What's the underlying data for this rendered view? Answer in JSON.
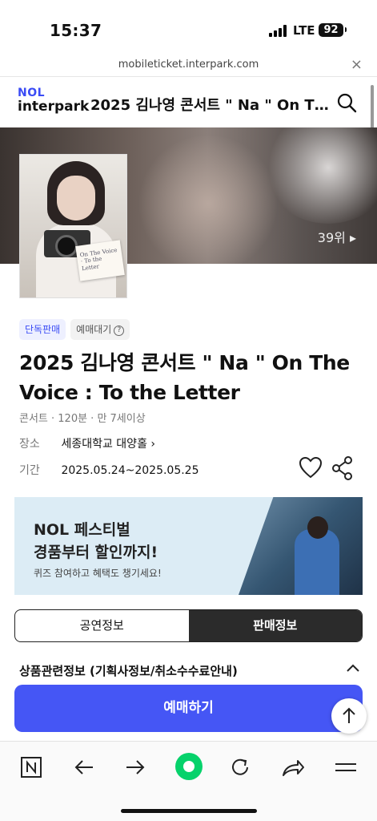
{
  "status": {
    "time": "15:37",
    "network": "LTE",
    "battery": "92"
  },
  "browser": {
    "url": "mobileticket.interpark.com",
    "close_glyph": "×"
  },
  "header": {
    "logo_top": "NOL",
    "logo_bottom": "interpark",
    "title": "2025 김나영 콘서트 \" Na \" On Th..."
  },
  "hero": {
    "rank": "39위 ▸"
  },
  "poster": {
    "card_text": "On The Voice · To the Letter"
  },
  "badges": {
    "exclusive": "단독판매",
    "waiting": "예매대기",
    "help": "?"
  },
  "product": {
    "title": "2025 김나영 콘서트 \" Na \" On The Voice : To the Letter",
    "meta": "콘서트 · 120분 · 만 7세이상",
    "venue_label": "장소",
    "venue": "세종대학교 대양홀 ›",
    "period_label": "기간",
    "period": "2025.05.24~2025.05.25"
  },
  "banner": {
    "line1": "NOL 페스티벌",
    "line2": "경품부터 할인까지!",
    "line3": "퀴즈 참여하고 혜택도 챙기세요!"
  },
  "tabs": [
    {
      "label": "공연정보"
    },
    {
      "label": "판매정보"
    }
  ],
  "section": {
    "title": "상품관련정보 (기획사정보/취소수수료안내)"
  },
  "cta": {
    "label": "예매하기"
  },
  "colors": {
    "accent": "#4556f5",
    "brand": "#3a4bf5",
    "dark_tab": "#2b2b2b"
  }
}
